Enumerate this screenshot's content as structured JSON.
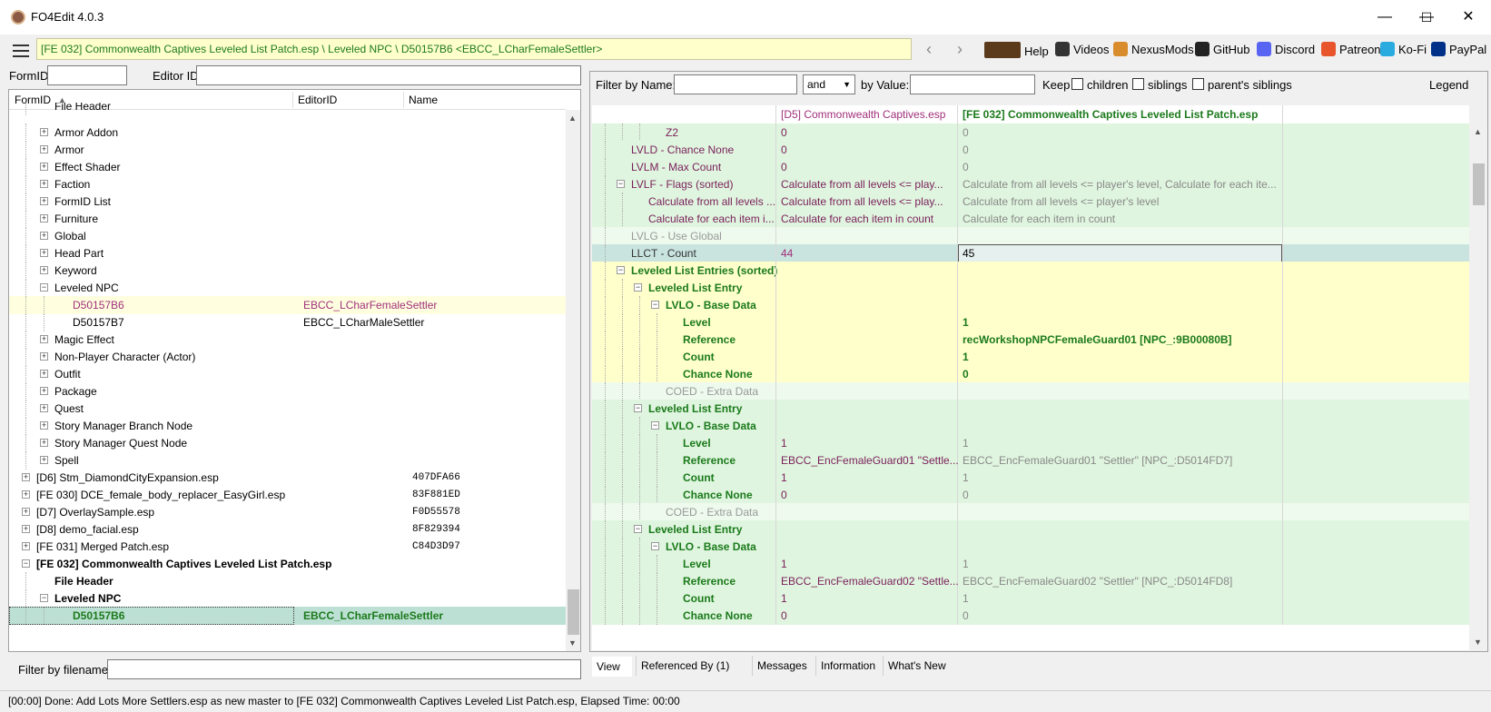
{
  "window": {
    "title": "FO4Edit 4.0.3",
    "minimize": "—",
    "maximize": "☐",
    "close": "✕"
  },
  "toolbar": {
    "path": "[FE 032] Commonwealth Captives Leveled List Patch.esp \\ Leveled NPC \\ D50157B6 <EBCC_LCharFemaleSettler>",
    "back": "‹",
    "forward": "›",
    "links": [
      {
        "label": "Help",
        "icon": "book-icon",
        "color": "#5a3a1a"
      },
      {
        "label": "Videos",
        "icon": "video-icon",
        "color": "#333333"
      },
      {
        "label": "NexusMods",
        "icon": "nexus-icon",
        "color": "#d98c2b"
      },
      {
        "label": "GitHub",
        "icon": "github-icon",
        "color": "#222222"
      },
      {
        "label": "Discord",
        "icon": "discord-icon",
        "color": "#5865f2"
      },
      {
        "label": "Patreon",
        "icon": "patreon-icon",
        "color": "#e8552d"
      },
      {
        "label": "Ko-Fi",
        "icon": "kofi-icon",
        "color": "#29abe0"
      },
      {
        "label": "PayPal",
        "icon": "paypal-icon",
        "color": "#003087"
      }
    ]
  },
  "left": {
    "formid_label": "FormID",
    "editorid_label": "Editor ID",
    "formid_value": "",
    "editorid_value": "",
    "columns": [
      "FormID",
      "EditorID",
      "Name"
    ],
    "filter_label": "Filter by filename:",
    "filter_value": ""
  },
  "tree": [
    {
      "indent": 1,
      "exp": "",
      "c1": "File Header",
      "c2": "",
      "c3": "",
      "style": "cut"
    },
    {
      "indent": 1,
      "exp": "+",
      "c1": "Armor Addon",
      "c2": "",
      "c3": ""
    },
    {
      "indent": 1,
      "exp": "+",
      "c1": "Armor",
      "c2": "",
      "c3": ""
    },
    {
      "indent": 1,
      "exp": "+",
      "c1": "Effect Shader",
      "c2": "",
      "c3": ""
    },
    {
      "indent": 1,
      "exp": "+",
      "c1": "Faction",
      "c2": "",
      "c3": ""
    },
    {
      "indent": 1,
      "exp": "+",
      "c1": "FormID List",
      "c2": "",
      "c3": ""
    },
    {
      "indent": 1,
      "exp": "+",
      "c1": "Furniture",
      "c2": "",
      "c3": ""
    },
    {
      "indent": 1,
      "exp": "+",
      "c1": "Global",
      "c2": "",
      "c3": ""
    },
    {
      "indent": 1,
      "exp": "+",
      "c1": "Head Part",
      "c2": "",
      "c3": ""
    },
    {
      "indent": 1,
      "exp": "+",
      "c1": "Keyword",
      "c2": "",
      "c3": ""
    },
    {
      "indent": 1,
      "exp": "−",
      "c1": "Leveled NPC",
      "c2": "",
      "c3": ""
    },
    {
      "indent": 2,
      "exp": "",
      "c1": "D50157B6",
      "c2": "EBCC_LCharFemaleSettler",
      "c3": "",
      "style": "hl"
    },
    {
      "indent": 2,
      "exp": "",
      "c1": "D50157B7",
      "c2": "EBCC_LCharMaleSettler",
      "c3": ""
    },
    {
      "indent": 1,
      "exp": "+",
      "c1": "Magic Effect",
      "c2": "",
      "c3": ""
    },
    {
      "indent": 1,
      "exp": "+",
      "c1": "Non-Player Character (Actor)",
      "c2": "",
      "c3": ""
    },
    {
      "indent": 1,
      "exp": "+",
      "c1": "Outfit",
      "c2": "",
      "c3": ""
    },
    {
      "indent": 1,
      "exp": "+",
      "c1": "Package",
      "c2": "",
      "c3": ""
    },
    {
      "indent": 1,
      "exp": "+",
      "c1": "Quest",
      "c2": "",
      "c3": ""
    },
    {
      "indent": 1,
      "exp": "+",
      "c1": "Story Manager Branch Node",
      "c2": "",
      "c3": ""
    },
    {
      "indent": 1,
      "exp": "+",
      "c1": "Story Manager Quest Node",
      "c2": "",
      "c3": ""
    },
    {
      "indent": 1,
      "exp": "+",
      "c1": "Spell",
      "c2": "",
      "c3": ""
    },
    {
      "indent": 0,
      "exp": "+",
      "c1": "[D6] Stm_DiamondCityExpansion.esp",
      "c2": "",
      "c3": "407DFA66"
    },
    {
      "indent": 0,
      "exp": "+",
      "c1": "[FE 030] DCE_female_body_replacer_EasyGirl.esp",
      "c2": "",
      "c3": "83F881ED"
    },
    {
      "indent": 0,
      "exp": "+",
      "c1": "[D7] OverlaySample.esp",
      "c2": "",
      "c3": "F0D55578"
    },
    {
      "indent": 0,
      "exp": "+",
      "c1": "[D8] demo_facial.esp",
      "c2": "",
      "c3": "8F829394"
    },
    {
      "indent": 0,
      "exp": "+",
      "c1": "[FE 031] Merged Patch.esp",
      "c2": "",
      "c3": "C84D3D97"
    },
    {
      "indent": 0,
      "exp": "−",
      "c1": "[FE 032] Commonwealth Captives Leveled List Patch.esp",
      "c2": "",
      "c3": "",
      "style": "bold"
    },
    {
      "indent": 1,
      "exp": "",
      "c1": "File Header",
      "c2": "",
      "c3": "",
      "style": "bold"
    },
    {
      "indent": 1,
      "exp": "−",
      "c1": "Leveled NPC",
      "c2": "",
      "c3": "",
      "style": "bold"
    },
    {
      "indent": 2,
      "exp": "",
      "c1": "D50157B6",
      "c2": "EBCC_LCharFemaleSettler",
      "c3": "",
      "style": "sel"
    }
  ],
  "right": {
    "filter_name_label": "Filter by Name:",
    "filter_name_value": "",
    "op_value": "and",
    "filter_value_label": "by Value:",
    "filter_value_value": "",
    "keep_label": "Keep",
    "children_label": "children",
    "siblings_label": "siblings",
    "parents_siblings_label": "parent's siblings",
    "legend_label": "Legend",
    "col_master": "[D5] Commonwealth Captives.esp",
    "col_patch": "[FE 032] Commonwealth Captives Leveled List Patch.esp"
  },
  "grid": [
    {
      "indent": 3,
      "exp": "",
      "k": "Z2",
      "v1": "0",
      "v2": "0",
      "bg": "#dff5df",
      "kc": "#7a1f5a",
      "v2c": "#888888"
    },
    {
      "indent": 1,
      "exp": "",
      "k": "LVLD - Chance None",
      "v1": "0",
      "v2": "0",
      "bg": "#dff5df",
      "kc": "#7a1f5a",
      "v2c": "#888888"
    },
    {
      "indent": 1,
      "exp": "",
      "k": "LVLM - Max Count",
      "v1": "0",
      "v2": "0",
      "bg": "#dff5df",
      "kc": "#7a1f5a",
      "v2c": "#888888"
    },
    {
      "indent": 1,
      "exp": "−",
      "k": "LVLF - Flags (sorted)",
      "v1": "Calculate from all levels <= play...",
      "v2": "Calculate from all levels <= player's level, Calculate for each ite...",
      "bg": "#dff5df",
      "kc": "#7a1f5a",
      "v2c": "#888888"
    },
    {
      "indent": 2,
      "exp": "",
      "k": "Calculate from all levels ...",
      "v1": "Calculate from all levels <= play...",
      "v2": "Calculate from all levels <= player's level",
      "bg": "#dff5df",
      "kc": "#7a1f5a",
      "v2c": "#888888"
    },
    {
      "indent": 2,
      "exp": "",
      "k": "Calculate for each item i...",
      "v1": "Calculate for each item in count",
      "v2": "Calculate for each item in count",
      "bg": "#dff5df",
      "kc": "#7a1f5a",
      "v2c": "#888888"
    },
    {
      "indent": 1,
      "exp": "",
      "k": "LVLG - Use Global",
      "v1": "",
      "v2": "",
      "bg": "#eefaee",
      "kc": "#999999",
      "v2c": "#888888"
    },
    {
      "indent": 1,
      "exp": "",
      "k": "LLCT - Count",
      "v1": "44",
      "v2": "45",
      "bg": "#c9e4df",
      "kc": "#333333",
      "v1c": "#a0307a",
      "v2c": "#000000",
      "sel": true
    },
    {
      "indent": 1,
      "exp": "−",
      "k": "Leveled List Entries (sorted)",
      "v1": "",
      "v2": "",
      "bg": "#ffffcc",
      "kc": "#1b7a1b",
      "bold": true
    },
    {
      "indent": 2,
      "exp": "−",
      "k": "Leveled List Entry",
      "v1": "",
      "v2": "",
      "bg": "#ffffcc",
      "kc": "#1b7a1b",
      "bold": true
    },
    {
      "indent": 3,
      "exp": "−",
      "k": "LVLO - Base Data",
      "v1": "",
      "v2": "",
      "bg": "#ffffcc",
      "kc": "#1b7a1b",
      "bold": true
    },
    {
      "indent": 4,
      "exp": "",
      "k": "Level",
      "v1": "",
      "v2": "1",
      "bg": "#ffffcc",
      "kc": "#1b7a1b",
      "v2c": "#1b7a1b",
      "bold": true
    },
    {
      "indent": 4,
      "exp": "",
      "k": "Reference",
      "v1": "",
      "v2": "recWorkshopNPCFemaleGuard01 [NPC_:9B00080B]",
      "bg": "#ffffcc",
      "kc": "#1b7a1b",
      "v2c": "#1b7a1b",
      "bold": true
    },
    {
      "indent": 4,
      "exp": "",
      "k": "Count",
      "v1": "",
      "v2": "1",
      "bg": "#ffffcc",
      "kc": "#1b7a1b",
      "v2c": "#1b7a1b",
      "bold": true
    },
    {
      "indent": 4,
      "exp": "",
      "k": "Chance None",
      "v1": "",
      "v2": "0",
      "bg": "#ffffcc",
      "kc": "#1b7a1b",
      "v2c": "#1b7a1b",
      "bold": true
    },
    {
      "indent": 3,
      "exp": "",
      "k": "COED - Extra Data",
      "v1": "",
      "v2": "",
      "bg": "#eefaee",
      "kc": "#999999"
    },
    {
      "indent": 2,
      "exp": "−",
      "k": "Leveled List Entry",
      "v1": "",
      "v2": "",
      "bg": "#dff5df",
      "kc": "#1b7a1b",
      "bold": true
    },
    {
      "indent": 3,
      "exp": "−",
      "k": "LVLO - Base Data",
      "v1": "",
      "v2": "",
      "bg": "#dff5df",
      "kc": "#1b7a1b",
      "bold": true
    },
    {
      "indent": 4,
      "exp": "",
      "k": "Level",
      "v1": "1",
      "v2": "1",
      "bg": "#dff5df",
      "kc": "#1b7a1b",
      "v2c": "#888888",
      "bold": true
    },
    {
      "indent": 4,
      "exp": "",
      "k": "Reference",
      "v1": "EBCC_EncFemaleGuard01 \"Settle...",
      "v2": "EBCC_EncFemaleGuard01 \"Settler\" [NPC_:D5014FD7]",
      "bg": "#dff5df",
      "kc": "#1b7a1b",
      "v2c": "#888888",
      "bold": true
    },
    {
      "indent": 4,
      "exp": "",
      "k": "Count",
      "v1": "1",
      "v2": "1",
      "bg": "#dff5df",
      "kc": "#1b7a1b",
      "v2c": "#888888",
      "bold": true
    },
    {
      "indent": 4,
      "exp": "",
      "k": "Chance None",
      "v1": "0",
      "v2": "0",
      "bg": "#dff5df",
      "kc": "#1b7a1b",
      "v2c": "#888888",
      "bold": true
    },
    {
      "indent": 3,
      "exp": "",
      "k": "COED - Extra Data",
      "v1": "",
      "v2": "",
      "bg": "#eefaee",
      "kc": "#999999"
    },
    {
      "indent": 2,
      "exp": "−",
      "k": "Leveled List Entry",
      "v1": "",
      "v2": "",
      "bg": "#dff5df",
      "kc": "#1b7a1b",
      "bold": true
    },
    {
      "indent": 3,
      "exp": "−",
      "k": "LVLO - Base Data",
      "v1": "",
      "v2": "",
      "bg": "#dff5df",
      "kc": "#1b7a1b",
      "bold": true
    },
    {
      "indent": 4,
      "exp": "",
      "k": "Level",
      "v1": "1",
      "v2": "1",
      "bg": "#dff5df",
      "kc": "#1b7a1b",
      "v2c": "#888888",
      "bold": true
    },
    {
      "indent": 4,
      "exp": "",
      "k": "Reference",
      "v1": "EBCC_EncFemaleGuard02 \"Settle...",
      "v2": "EBCC_EncFemaleGuard02 \"Settler\" [NPC_:D5014FD8]",
      "bg": "#dff5df",
      "kc": "#1b7a1b",
      "v2c": "#888888",
      "bold": true
    },
    {
      "indent": 4,
      "exp": "",
      "k": "Count",
      "v1": "1",
      "v2": "1",
      "bg": "#dff5df",
      "kc": "#1b7a1b",
      "v2c": "#888888",
      "bold": true
    },
    {
      "indent": 4,
      "exp": "",
      "k": "Chance None",
      "v1": "0",
      "v2": "0",
      "bg": "#dff5df",
      "kc": "#1b7a1b",
      "v2c": "#888888",
      "bold": true
    }
  ],
  "tabs": [
    "View",
    "Referenced By (1)",
    "Messages",
    "Information",
    "What's New"
  ],
  "status": "[00:00] Done: Add Lots More Settlers.esp as new master to [FE 032] Commonwealth Captives Leveled List Patch.esp, Elapsed Time: 00:00"
}
